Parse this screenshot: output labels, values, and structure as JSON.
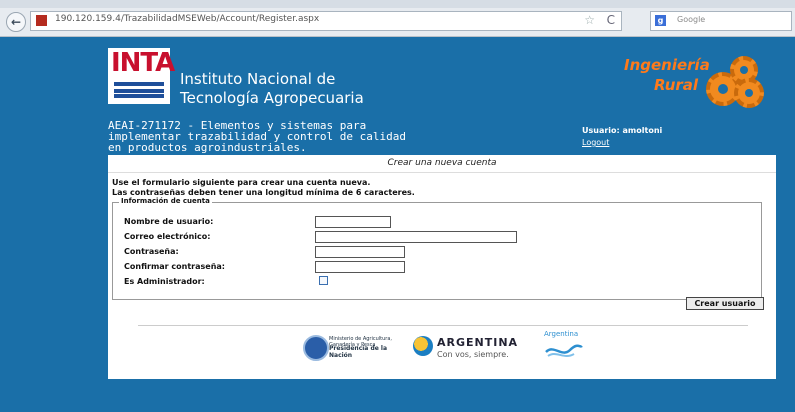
{
  "browser": {
    "url": "190.120.159.4/TrazabilidadMSEWeb/Account/Register.aspx",
    "search_placeholder": "Google",
    "back_glyph": "←",
    "star_glyph": "☆",
    "reload_glyph": "C"
  },
  "header": {
    "logo_text": "INTA",
    "institute_line1": "Instituto Nacional de",
    "institute_line2": "Tecnología Agropecuaria",
    "brand_line1": "Ingeniería",
    "brand_line2": "Rural",
    "project_line1": "AEAI-271172 - Elementos y sistemas para",
    "project_line2": "implementar trazabilidad y control de calidad",
    "project_line3": "en productos agroindustriales.",
    "user_label": "Usuario: amoltoni",
    "logout_label": "Logout"
  },
  "form": {
    "title": "Crear una nueva cuenta",
    "intro_line1": "Use el formulario siguiente para crear una cuenta nueva.",
    "intro_line2": "Las contraseñas deben tener una longitud mínima de 6 caracteres.",
    "legend": "Información de cuenta",
    "fields": {
      "username": {
        "label": "Nombre de usuario:",
        "value": ""
      },
      "email": {
        "label": "Correo electrónico:",
        "value": ""
      },
      "password": {
        "label": "Contraseña:",
        "value": ""
      },
      "confirm": {
        "label": "Confirmar contraseña:",
        "value": ""
      },
      "admin": {
        "label": "Es Administrador:",
        "checked": false
      }
    },
    "submit_label": "Crear usuario"
  },
  "footer": {
    "ministry_line1": "Ministerio de Agricultura, Ganadería y Pesca",
    "ministry_line2": "Presidencia de la Nación",
    "argentina_title": "ARGENTINA",
    "argentina_slogan": "Con vos, siempre.",
    "argentina_mark": "Argentina"
  },
  "colors": {
    "background": "#1a6fa8",
    "accent": "#ff7a1a"
  }
}
